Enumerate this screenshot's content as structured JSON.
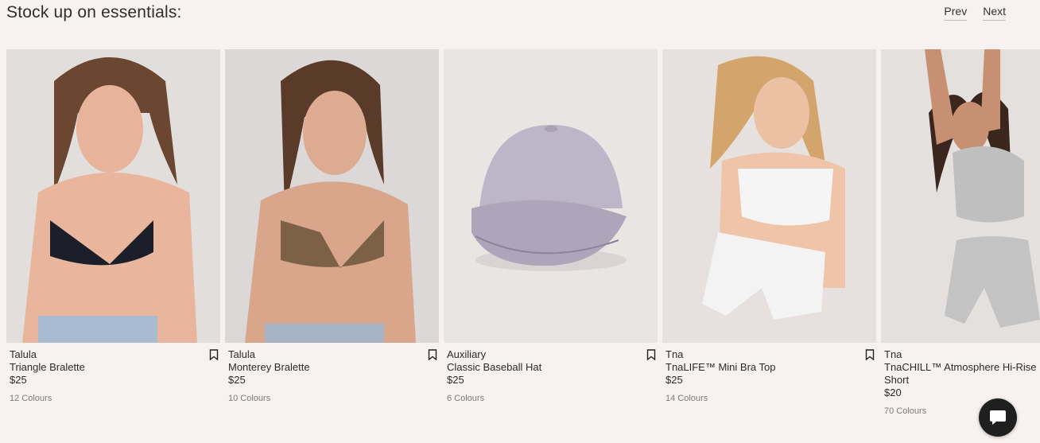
{
  "section": {
    "title": "Stock up on essentials:",
    "prev_label": "Prev",
    "next_label": "Next"
  },
  "products": [
    {
      "brand": "Talula",
      "name": "Triangle Bralette",
      "price": "$25",
      "colours": "12 Colours"
    },
    {
      "brand": "Talula",
      "name": "Monterey Bralette",
      "price": "$25",
      "colours": "10 Colours"
    },
    {
      "brand": "Auxiliary",
      "name": "Classic Baseball Hat",
      "price": "$25",
      "colours": "6 Colours"
    },
    {
      "brand": "Tna",
      "name": "TnaLIFE™ Mini Bra Top",
      "price": "$25",
      "colours": "14 Colours"
    },
    {
      "brand": "Tna",
      "name": "TnaCHILL™ Atmosphere Hi-Rise Short",
      "price": "$20",
      "colours": "70 Colours"
    }
  ],
  "icons": {
    "bookmark": "bookmark-icon",
    "chat": "chat-icon"
  }
}
